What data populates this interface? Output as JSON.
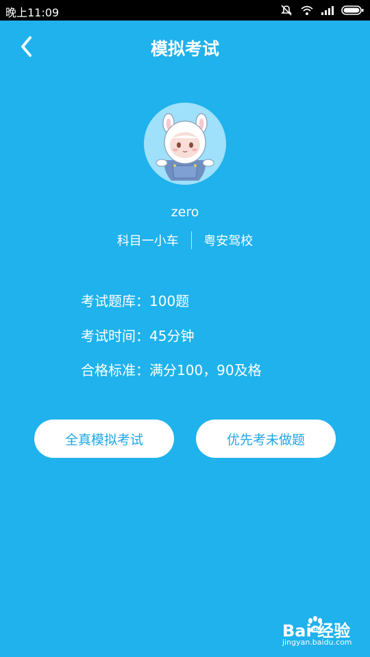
{
  "status_bar": {
    "time": "晚上11:09"
  },
  "header": {
    "title": "模拟考试"
  },
  "profile": {
    "username": "zero",
    "subject": "科目一小车",
    "school": "粤安驾校"
  },
  "exam_info": [
    {
      "text": "考试题库：100题"
    },
    {
      "text": "考试时间：45分钟"
    },
    {
      "text": "合格标准：满分100，90及格"
    }
  ],
  "actions": {
    "full_exam": "全真模拟考试",
    "unanswered_exam": "优先考未做题"
  },
  "watermark": {
    "brand": "Bai  经验",
    "url": "jingyan.baidu.com"
  },
  "colors": {
    "background": "#1fb2ec",
    "button_text": "#1ea6e6",
    "status_bar": "#000000"
  }
}
